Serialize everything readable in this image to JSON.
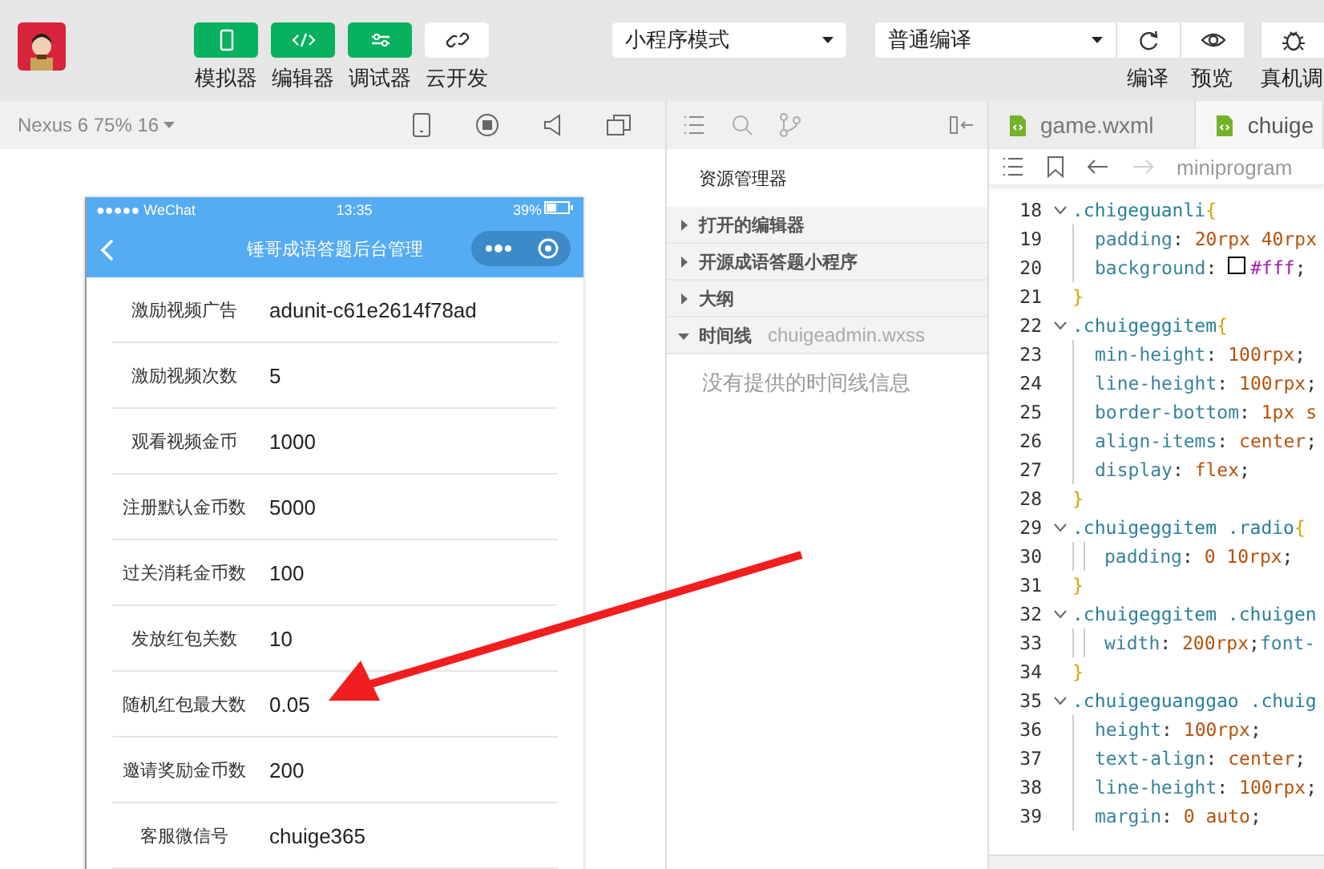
{
  "toolbar": {
    "mode_buttons": [
      {
        "label": "模拟器",
        "on": true
      },
      {
        "label": "编辑器",
        "on": true
      },
      {
        "label": "调试器",
        "on": true
      },
      {
        "label": "云开发",
        "on": false
      }
    ],
    "mode_select": {
      "value": "小程序模式"
    },
    "compile_select": {
      "value": "普通编译"
    },
    "actions": [
      {
        "label": "编译"
      },
      {
        "label": "预览"
      },
      {
        "label": "真机调"
      }
    ]
  },
  "simulator": {
    "device": "Nexus 6 75% 16",
    "phone": {
      "carrier": "●●●●● WeChat",
      "time": "13:35",
      "battery": "39%",
      "title": "锤哥成语答题后台管理",
      "rows": [
        {
          "label": "激励视频广告",
          "value": "adunit-c61e2614f78ad"
        },
        {
          "label": "激励视频次数",
          "value": "5"
        },
        {
          "label": "观看视频金币",
          "value": "1000"
        },
        {
          "label": "注册默认金币数",
          "value": "5000"
        },
        {
          "label": "过关消耗金币数",
          "value": "100"
        },
        {
          "label": "发放红包关数",
          "value": "10"
        },
        {
          "label": "随机红包最大数",
          "value": "0.05"
        },
        {
          "label": "邀请奖励金币数",
          "value": "200"
        },
        {
          "label": "客服微信号",
          "value": "chuige365"
        }
      ]
    }
  },
  "explorer": {
    "title": "资源管理器",
    "sections": [
      {
        "label": "打开的编辑器",
        "expanded": false
      },
      {
        "label": "开源成语答题小程序",
        "expanded": false
      },
      {
        "label": "大纲",
        "expanded": false
      },
      {
        "label": "时间线",
        "expanded": true,
        "detail": "chuigeadmin.wxss"
      }
    ],
    "timeline_message": "没有提供的时间线信息"
  },
  "editor": {
    "tabs": [
      {
        "label": "game.wxml",
        "selected": false
      },
      {
        "label": "chuige",
        "selected": true
      }
    ],
    "breadcrumb": "miniprogram",
    "lines": [
      {
        "number": "18",
        "kind": "selector",
        "tokens": [
          {
            "kind": "sel",
            "s": ".chigeguanli"
          },
          {
            "kind": "brace",
            "s": "{"
          }
        ]
      },
      {
        "number": "19",
        "kind": "declaration",
        "tokens": [
          {
            "kind": "prop",
            "s": "padding"
          },
          {
            "kind": "punct",
            "s": ": "
          },
          {
            "kind": "val",
            "s": "20rpx 40rpx"
          }
        ]
      },
      {
        "number": "20",
        "kind": "declaration",
        "tokens": [
          {
            "kind": "prop",
            "s": "background"
          },
          {
            "kind": "punct",
            "s": ": "
          },
          {
            "kind": "swatch"
          },
          {
            "kind": "color",
            "s": "#fff"
          },
          {
            "kind": "punct",
            "s": ";"
          }
        ]
      },
      {
        "number": "21",
        "kind": "close",
        "tokens": [
          {
            "kind": "brace",
            "s": "}"
          }
        ]
      },
      {
        "number": "22",
        "kind": "selector",
        "tokens": [
          {
            "kind": "sel",
            "s": ".chuigeggitem"
          },
          {
            "kind": "brace",
            "s": "{"
          }
        ]
      },
      {
        "number": "23",
        "kind": "declaration",
        "tokens": [
          {
            "kind": "prop",
            "s": "min-height"
          },
          {
            "kind": "punct",
            "s": ": "
          },
          {
            "kind": "val",
            "s": "100rpx"
          },
          {
            "kind": "punct",
            "s": ";"
          }
        ]
      },
      {
        "number": "24",
        "kind": "declaration",
        "tokens": [
          {
            "kind": "prop",
            "s": "line-height"
          },
          {
            "kind": "punct",
            "s": ": "
          },
          {
            "kind": "val",
            "s": "100rpx"
          },
          {
            "kind": "punct",
            "s": ";"
          }
        ]
      },
      {
        "number": "25",
        "kind": "declaration",
        "tokens": [
          {
            "kind": "prop",
            "s": "border-bottom"
          },
          {
            "kind": "punct",
            "s": ": "
          },
          {
            "kind": "val",
            "s": "1px s"
          }
        ]
      },
      {
        "number": "26",
        "kind": "declaration",
        "tokens": [
          {
            "kind": "prop",
            "s": "align-items"
          },
          {
            "kind": "punct",
            "s": ": "
          },
          {
            "kind": "val",
            "s": "center"
          },
          {
            "kind": "punct",
            "s": ";"
          }
        ]
      },
      {
        "number": "27",
        "kind": "declaration",
        "tokens": [
          {
            "kind": "prop",
            "s": "display"
          },
          {
            "kind": "punct",
            "s": ": "
          },
          {
            "kind": "val",
            "s": "flex"
          },
          {
            "kind": "punct",
            "s": ";"
          }
        ]
      },
      {
        "number": "28",
        "kind": "close",
        "tokens": [
          {
            "kind": "brace",
            "s": "}"
          }
        ]
      },
      {
        "number": "29",
        "kind": "selector",
        "tokens": [
          {
            "kind": "sel",
            "s": ".chuigeggitem .radio"
          },
          {
            "kind": "brace",
            "s": "{"
          }
        ]
      },
      {
        "number": "30",
        "kind": "nested",
        "tokens": [
          {
            "kind": "prop",
            "s": "padding"
          },
          {
            "kind": "punct",
            "s": ": "
          },
          {
            "kind": "val",
            "s": "0 10rpx"
          },
          {
            "kind": "punct",
            "s": ";"
          }
        ]
      },
      {
        "number": "31",
        "kind": "close",
        "tokens": [
          {
            "kind": "brace",
            "s": "}"
          }
        ]
      },
      {
        "number": "32",
        "kind": "selector",
        "tokens": [
          {
            "kind": "sel",
            "s": ".chuigeggitem .chuigen"
          }
        ]
      },
      {
        "number": "33",
        "kind": "nested",
        "tokens": [
          {
            "kind": "prop",
            "s": "width"
          },
          {
            "kind": "punct",
            "s": ": "
          },
          {
            "kind": "val",
            "s": "200rpx"
          },
          {
            "kind": "punct",
            "s": ";"
          },
          {
            "kind": "prop",
            "s": "font-"
          }
        ]
      },
      {
        "number": "34",
        "kind": "close",
        "tokens": [
          {
            "kind": "brace",
            "s": "}"
          }
        ]
      },
      {
        "number": "35",
        "kind": "selector",
        "tokens": [
          {
            "kind": "sel",
            "s": ".chuigeguanggao .chuig"
          }
        ]
      },
      {
        "number": "36",
        "kind": "declaration",
        "tokens": [
          {
            "kind": "prop",
            "s": "height"
          },
          {
            "kind": "punct",
            "s": ": "
          },
          {
            "kind": "val",
            "s": "100rpx"
          },
          {
            "kind": "punct",
            "s": ";"
          }
        ]
      },
      {
        "number": "37",
        "kind": "declaration",
        "tokens": [
          {
            "kind": "prop",
            "s": "text-align"
          },
          {
            "kind": "punct",
            "s": ": "
          },
          {
            "kind": "val",
            "s": "center"
          },
          {
            "kind": "punct",
            "s": ";"
          }
        ]
      },
      {
        "number": "38",
        "kind": "declaration",
        "tokens": [
          {
            "kind": "prop",
            "s": "line-height"
          },
          {
            "kind": "punct",
            "s": ": "
          },
          {
            "kind": "val",
            "s": "100rpx"
          },
          {
            "kind": "punct",
            "s": ";"
          }
        ]
      },
      {
        "number": "39",
        "kind": "declaration",
        "tokens": [
          {
            "kind": "prop",
            "s": "margin"
          },
          {
            "kind": "punct",
            "s": ": "
          },
          {
            "kind": "val",
            "s": "0 auto"
          },
          {
            "kind": "punct",
            "s": ";"
          }
        ]
      }
    ]
  }
}
